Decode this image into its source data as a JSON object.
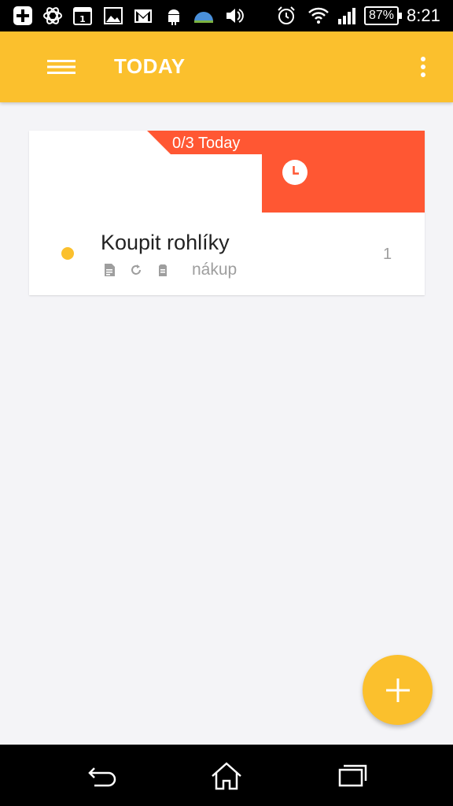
{
  "status_bar": {
    "battery_percent": "87%",
    "time": "8:21",
    "icons": [
      "add-box-icon",
      "atom-icon",
      "calendar-icon",
      "image-icon",
      "gmail-icon",
      "android-debug-icon",
      "weather-icon",
      "volume-icon",
      "alarm-icon",
      "wifi-icon",
      "signal-icon"
    ],
    "calendar_day": "1"
  },
  "app_bar": {
    "title": "TODAY",
    "background_color": "#fbc02d"
  },
  "task_card": {
    "tag_text": "0/3 Today",
    "accent_color": "#ff5733",
    "task": {
      "title": "Koupit rohlíky",
      "list_name": "nákup",
      "count": "1",
      "status_color": "#fbc02d",
      "meta_icons": [
        "note-icon",
        "repeat-icon",
        "attachment-icon"
      ]
    }
  },
  "fab": {
    "icon": "plus-icon",
    "color": "#fbc02d"
  },
  "nav_bar": {
    "buttons": [
      "back-icon",
      "home-icon",
      "recents-icon"
    ]
  }
}
